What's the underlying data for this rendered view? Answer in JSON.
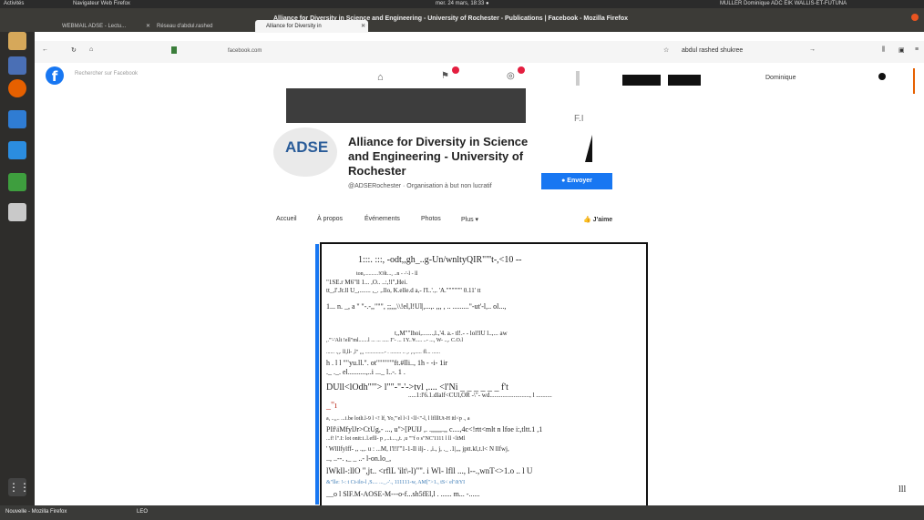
{
  "system": {
    "activities": "Activités",
    "app_name": "Navigateur Web Firefox",
    "clock": "mer. 24 mars, 18:33 ●",
    "user_label": "MULLER Dominique ADC EIK WALLIS-ET-FUTUNA"
  },
  "window_title": "Alliance for Diversity in Science and Engineering - University of Rochester - Publications | Facebook - Mozilla Firefox",
  "tabs": [
    {
      "label": "WEBMAIL ADSE - Lectu..."
    },
    {
      "label": "Réseau d'abdul.rashed"
    },
    {
      "label": "Alliance for Diversity in"
    }
  ],
  "url": "facebook.com",
  "toolbar": {
    "user_search": "abdul rashed shukree",
    "account_name": "Dominique"
  },
  "facebook": {
    "search_placeholder": "Rechercher sur Facebook",
    "page_name": "Alliance for Diversity in Science and Engineering - University of Rochester",
    "logo_text": "ADSE",
    "handle": "@ADSERochester · Organisation à but non lucratif",
    "send_button": "Envoyer",
    "page_nav": [
      "Accueil",
      "À propos",
      "Événements",
      "Photos",
      "Plus ▾"
    ],
    "like_button": "J'aime",
    "fragment": "F.I"
  },
  "card": {
    "title_line": "1:::. :::, -odt,,gh_..g-Un/wnltyQIR\"\"'t-,<10 --",
    "line1": "ton,..........!Olt..., ..n - -'-l - ll",
    "line2": "\"1SE.r M6\"ll 1... ,O.. ..:,!l\",Hei.",
    "line3": "tt_,l'.Jr.ll U_,....... ,_. ,.llo, K.elle.d a,- l'I..'.,. 'A.\"\"\"\"\"\" 0.11' tt",
    "line4": "1... n. _,  a '' \"-.-,,\"\"\", ;;,,,\\\\!el,l!Ul|,...,. ,,, , .. .........\"-ut'-l,.. ol...,",
    "line5": "t,,M\"\"lhoi,.......,l.,'4. a.- tl!.- - lol!lU l..,... aw",
    "line6": ",.\"'-'Alt !ell\"ml.......l ... ... .....  I\"- ... 1Y..'#..... ..- ..., W- ..,. C.O.l",
    "line7": "...... .,,. ll,ll- ,l\"  ,,, ..............- . ........ .. ,. ,.,..... fl... ......",
    "line8": "h .          l l \"\"yu.ll.\". ot\"\"\"\"\"\"ft.#lli.., 1h - -i- 1ir",
    "line9": "._ ._.         el..........,..i ..._ l..-. 1 .",
    "line10": "DUll<lOdh\"\"'> l\"\"-\"-'->tvl ,.... <l'Ni  _ _ _ _ _ _ f't",
    "line11": ".....1:l'6.1.dlalf<CUl,OR -\\\"- wd........................., l ..........",
    "line12": "_\"ı",
    "line13": "a, ..,,.. ...i.be lotli.l-9 l <!   lf,                    Yo,'\"el l<l <ll<\"-l, l lflllUt-H itl<p          ., a",
    "line14": "PIf\\iMfylJr>CtUg,- ..., u\">[PUIJ ,. .,,,,,,.,, c....,4c<!rtt<mlt n lfoe i:,tltt.1 ,1",
    "line15": "...f! l\".I: lot onit:i..l.efll- p              ,...i....,,t. ,u \"\"f o s\"NC'1111 l ll <ltMl",
    "line16": "' Wlllfylff- ,, .,,. u : ...M,          l'l!l\"'1-1-Il ilj- . ,i., j, ._ .1|,,, jptt.kl,t.l< N llfwj,",
    "line17": ".., ..--. ,_ _ ..- l-on.lo_,",
    "line18": "lWkll-:llO \",jt.. <rflL 'ilt\\-l)\"\". i Wl- lfll ...,  l--.,wnT<>1.o .. l U",
    "line19": "&\"lle: !-: t Ct-ilo-l ,S.... ..._.-'., 111111-w, AM[\">1., tS< el'\\ItYI",
    "line20": "__o l SlF.M-AOSE-M---o-f...sh5fEl,l .          ...... m... -......"
  },
  "marker": "lll",
  "bottom": {
    "task1": "Nouvelle - Mozilla Firefox",
    "task2": "LEO"
  }
}
